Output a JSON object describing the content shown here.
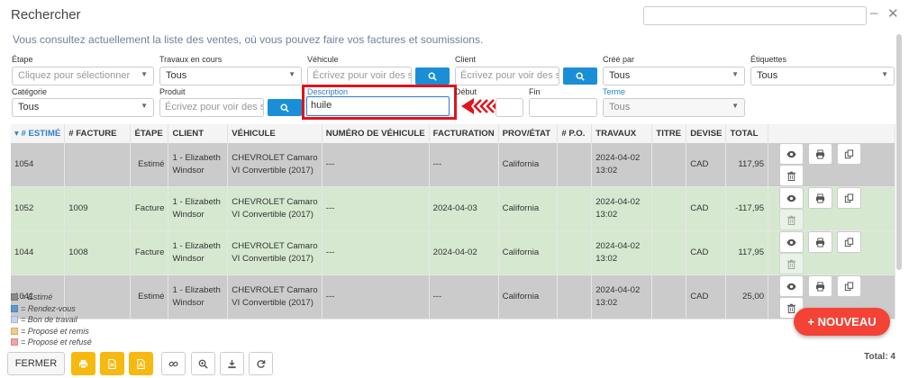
{
  "window": {
    "title": "Rechercher",
    "search_value": "",
    "min_glyph": "–",
    "close_glyph": "✕"
  },
  "subtitle": "Vous consultez actuellement la liste des ventes, où vous pouvez faire vos factures et soumissions.",
  "filters": {
    "etape": {
      "label": "Étape",
      "placeholder": "Cliquez pour sélectionner"
    },
    "travaux": {
      "label": "Travaux en cours",
      "value": "Tous"
    },
    "vehicule": {
      "label": "Véhicule",
      "placeholder": "Écrivez pour voir des s"
    },
    "client": {
      "label": "Client",
      "placeholder": "Écrivez pour voir des s"
    },
    "cree_par": {
      "label": "Créé par",
      "value": "Tous"
    },
    "etiquettes": {
      "label": "Étiquettes",
      "value": "Tous"
    },
    "categorie": {
      "label": "Catégorie",
      "value": "Tous"
    },
    "produit": {
      "label": "Produit",
      "placeholder": "Écrivez pour voir des s"
    },
    "description": {
      "label": "Description",
      "value": "huile"
    },
    "debut": {
      "label": "Début",
      "value": ""
    },
    "fin": {
      "label": "Fin",
      "value": ""
    },
    "terme": {
      "label": "Terme",
      "value": "Tous"
    }
  },
  "table": {
    "headers": [
      "# ESTIMÉ",
      "# FACTURE",
      "ÉTAPE",
      "CLIENT",
      "VÉHICULE",
      "NUMÉRO DE VÉHICULE",
      "FACTURATION",
      "PROV/ÉTAT",
      "# P.O.",
      "TRAVAUX",
      "TITRE",
      "DEVISE",
      "TOTAL"
    ],
    "sort_arrow": "▾",
    "rows": [
      {
        "estime": "1054",
        "facture": "",
        "etape": "Estimé",
        "client_l1": "1 - Elizabeth",
        "client_l2": "Windsor",
        "veh_l1": "CHEVROLET Camaro",
        "veh_l2": "VI Convertible (2017)",
        "num_veh": "---",
        "facturation": "---",
        "prov": "California",
        "po": "",
        "trav_l1": "2024-04-02",
        "trav_l2": "13:02",
        "titre": "",
        "devise": "CAD",
        "total": "117,95",
        "status": "estime"
      },
      {
        "estime": "1052",
        "facture": "1009",
        "etape": "Facture",
        "client_l1": "1 - Elizabeth",
        "client_l2": "Windsor",
        "veh_l1": "CHEVROLET Camaro",
        "veh_l2": "VI Convertible (2017)",
        "num_veh": "---",
        "facturation": "2024-04-03",
        "prov": "California",
        "po": "",
        "trav_l1": "2024-04-02",
        "trav_l2": "13:02",
        "titre": "",
        "devise": "CAD",
        "total": "-117,95",
        "status": "facture"
      },
      {
        "estime": "1044",
        "facture": "1008",
        "etape": "Facture",
        "client_l1": "1 - Elizabeth",
        "client_l2": "Windsor",
        "veh_l1": "CHEVROLET Camaro",
        "veh_l2": "VI Convertible (2017)",
        "num_veh": "---",
        "facturation": "2024-04-02",
        "prov": "California",
        "po": "",
        "trav_l1": "2024-04-02",
        "trav_l2": "13:02",
        "titre": "",
        "devise": "CAD",
        "total": "117,95",
        "status": "facture"
      },
      {
        "estime": "1041",
        "facture": "",
        "etape": "Estimé",
        "client_l1": "1 - Elizabeth",
        "client_l2": "Windsor",
        "veh_l1": "CHEVROLET Camaro",
        "veh_l2": "VI Convertible (2017)",
        "num_veh": "---",
        "facturation": "---",
        "prov": "California",
        "po": "",
        "trav_l1": "2024-04-02",
        "trav_l2": "13:02",
        "titre": "",
        "devise": "CAD",
        "total": "25,00",
        "status": "estime"
      }
    ]
  },
  "legend": [
    {
      "label": "= Estimé",
      "color": "#8a8a8a"
    },
    {
      "label": "= Rendez-vous",
      "color": "#5b9bd5"
    },
    {
      "label": "= Bon de travail",
      "color": "#c5d5f0"
    },
    {
      "label": "= Proposé et remis",
      "color": "#f7c98a"
    },
    {
      "label": "= Proposé et refusé",
      "color": "#f4a3a3"
    }
  ],
  "nouveau_label": "+ NOUVEAU",
  "footer": {
    "fermer_label": "FERMER",
    "total_label": "Total: 4"
  },
  "colors": {
    "accent": "#1a8fd8",
    "highlight": "#e0141c",
    "row_estime": "#cbcbcb",
    "row_facture": "#d6e8d0",
    "nouveau": "#f44336",
    "footer_yellow": "#f7b90f"
  }
}
